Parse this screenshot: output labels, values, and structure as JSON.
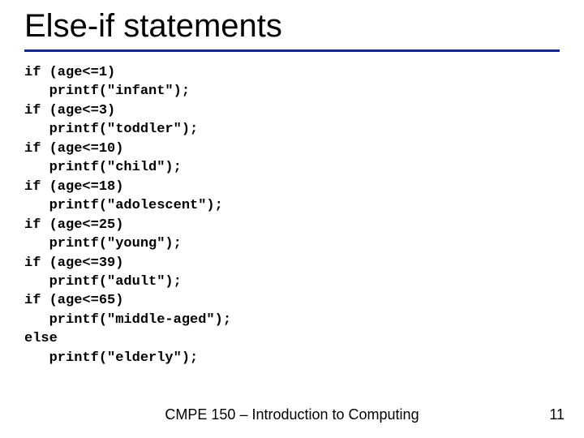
{
  "title": "Else-if statements",
  "code": "if (age<=1)\n   printf(\"infant\");\nif (age<=3)\n   printf(\"toddler\");\nif (age<=10)\n   printf(\"child\");\nif (age<=18)\n   printf(\"adolescent\");\nif (age<=25)\n   printf(\"young\");\nif (age<=39)\n   printf(\"adult\");\nif (age<=65)\n   printf(\"middle-aged\");\nelse\n   printf(\"elderly\");",
  "footer": "CMPE 150 – Introduction to Computing",
  "page_number": "11"
}
